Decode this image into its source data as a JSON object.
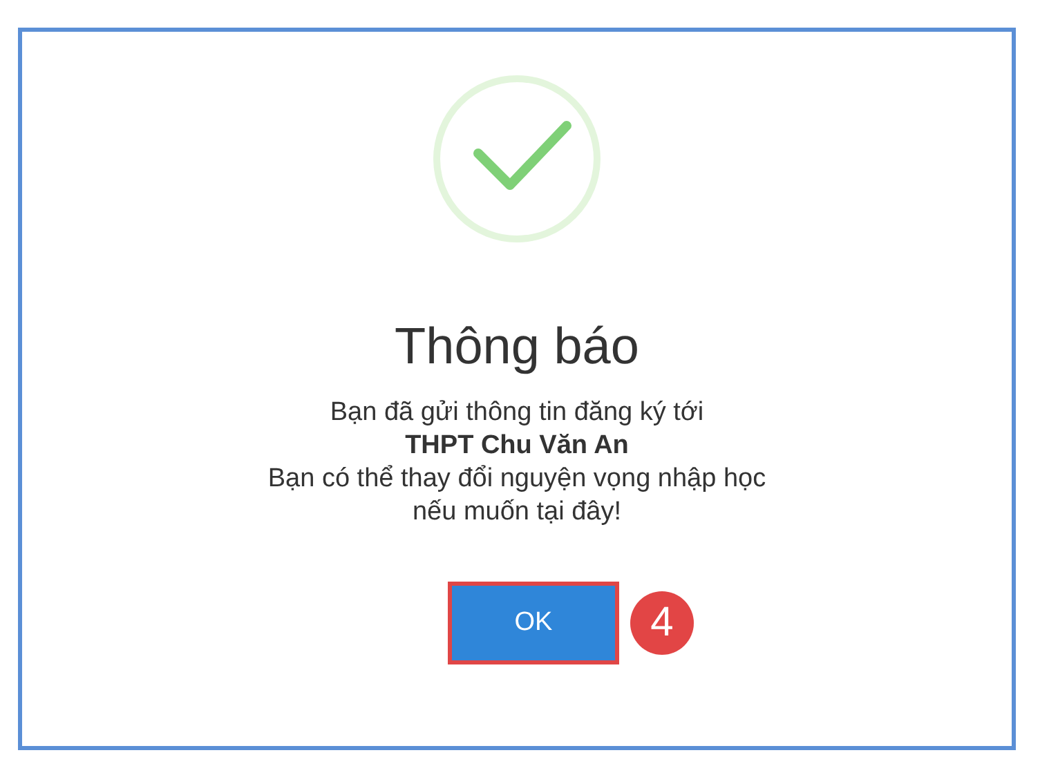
{
  "dialog": {
    "title": "Thông báo",
    "message": "Bạn đã gửi thông tin đăng ký tới\n**THPT Chu Văn An**\nBạn có thể thay đổi nguyện vọng nhập học\nnếu muốn tại đây!",
    "button": {
      "label": "OK",
      "highlighted": true
    },
    "step_badge": "4"
  }
}
